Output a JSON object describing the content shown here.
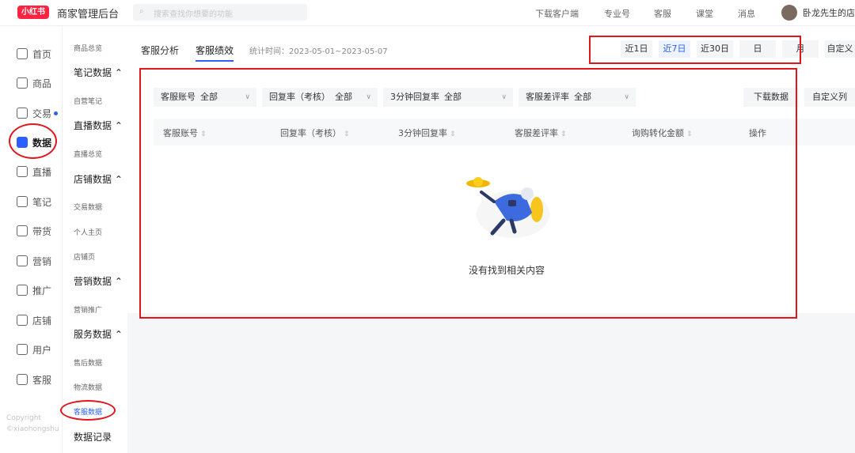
{
  "app": {
    "logo_text": "小红书",
    "title": "商家管理后台"
  },
  "search": {
    "placeholder": "搜索查找你想要的功能"
  },
  "topnav": [
    {
      "label": "下载客户端"
    },
    {
      "label": "专业号"
    },
    {
      "label": "客服"
    },
    {
      "label": "课堂"
    },
    {
      "label": "消息"
    }
  ],
  "user": {
    "name": "卧龙先生的店"
  },
  "sidebar": {
    "items": [
      {
        "label": "首页",
        "icon": "home-icon"
      },
      {
        "label": "商品",
        "icon": "goods-icon"
      },
      {
        "label": "交易",
        "icon": "trade-icon",
        "dot": true
      },
      {
        "label": "数据",
        "icon": "data-icon",
        "active": true
      },
      {
        "label": "直播",
        "icon": "live-icon"
      },
      {
        "label": "笔记",
        "icon": "note-icon"
      },
      {
        "label": "带货",
        "icon": "bag-icon"
      },
      {
        "label": "营销",
        "icon": "marketing-icon"
      },
      {
        "label": "推广",
        "icon": "promote-icon"
      },
      {
        "label": "店铺",
        "icon": "shop-icon"
      },
      {
        "label": "用户",
        "icon": "users-icon"
      },
      {
        "label": "客服",
        "icon": "service-icon"
      }
    ],
    "copyright": [
      "Copyright",
      "©xiaohongshu"
    ]
  },
  "subnav": {
    "overview": "商品总览",
    "groups": [
      {
        "title": "笔记数据",
        "items": [
          "自营笔记"
        ]
      },
      {
        "title": "直播数据",
        "items": [
          "直播总览"
        ]
      },
      {
        "title": "店铺数据",
        "items": [
          "交易数据",
          "个人主页",
          "店铺页"
        ]
      },
      {
        "title": "营销数据",
        "items": [
          "营销推广"
        ]
      },
      {
        "title": "服务数据",
        "items": [
          "售后数据",
          "物流数据",
          "客服数据"
        ]
      }
    ],
    "records": "数据记录"
  },
  "tabs": [
    {
      "label": "客服分析"
    },
    {
      "label": "客服绩效",
      "active": true
    }
  ],
  "stat_time": "统计时间：2023-05-01~2023-05-07",
  "date_buttons": [
    {
      "label": "近1日"
    },
    {
      "label": "近7日",
      "selected": true
    },
    {
      "label": "近30日"
    },
    {
      "label": "日"
    },
    {
      "label": "月"
    },
    {
      "label": "自定义"
    }
  ],
  "filters": [
    {
      "label": "客服账号",
      "value": "全部"
    },
    {
      "label": "回复率（考核）",
      "value": "全部"
    },
    {
      "label": "3分钟回复率",
      "value": "全部"
    },
    {
      "label": "客服差评率",
      "value": "全部"
    }
  ],
  "actions": {
    "download": "下载数据",
    "custom_columns": "自定义列"
  },
  "table": {
    "columns": [
      {
        "label": "客服账号",
        "sortable": true
      },
      {
        "label": "回复率（考核）",
        "sortable": true
      },
      {
        "label": "3分钟回复率",
        "sortable": true
      },
      {
        "label": "客服差评率",
        "sortable": true
      },
      {
        "label": "询购转化金额",
        "sortable": true
      },
      {
        "label": "操作",
        "sortable": false
      }
    ],
    "rows": []
  },
  "empty": {
    "text": "没有找到相关内容"
  },
  "colors": {
    "accent": "#2a60ff",
    "brand": "#ff2442",
    "annotation": "#e0161c"
  }
}
